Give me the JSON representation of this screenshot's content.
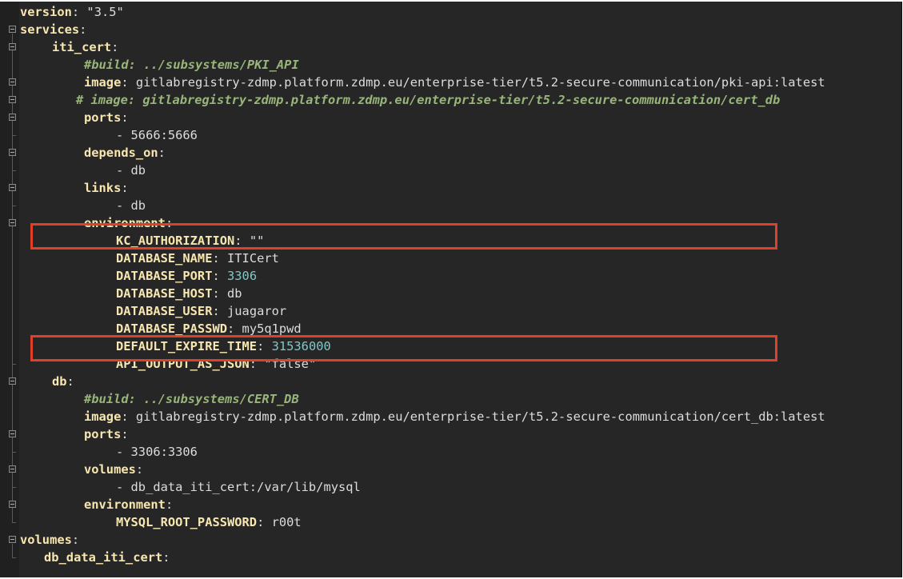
{
  "colors": {
    "editor_bg": "#262626",
    "key": "#f7e6b0",
    "text": "#dcdcdc",
    "number": "#7fc8c8",
    "comment": "#98b57a",
    "highlight_box": "#e0402a"
  },
  "lines": [
    {
      "indent": 0,
      "key": "version",
      "sep": ": ",
      "value": "\"3.5\"",
      "vtype": "plain"
    },
    {
      "indent": 0,
      "key": "services",
      "sep": ":",
      "value": "",
      "vtype": "plain"
    },
    {
      "indent": 4,
      "key": "iti_cert",
      "sep": ":",
      "value": "",
      "vtype": "plain"
    },
    {
      "indent": 8,
      "comment": "#build: ../subsystems/PKI_API"
    },
    {
      "indent": 8,
      "key": "image",
      "sep": ": ",
      "value": "gitlabregistry-zdmp.platform.zdmp.eu/enterprise-tier/t5.2-secure-communication/pki-api:latest",
      "vtype": "plain"
    },
    {
      "indent": 7,
      "comment": "# image: gitlabregistry-zdmp.platform.zdmp.eu/enterprise-tier/t5.2-secure-communication/cert_db"
    },
    {
      "indent": 8,
      "key": "ports",
      "sep": ":",
      "value": "",
      "vtype": "plain"
    },
    {
      "indent": 12,
      "text": "- 5666:5666"
    },
    {
      "indent": 8,
      "key": "depends_on",
      "sep": ":",
      "value": "",
      "vtype": "plain"
    },
    {
      "indent": 12,
      "text": "- db"
    },
    {
      "indent": 8,
      "key": "links",
      "sep": ":",
      "value": "",
      "vtype": "plain"
    },
    {
      "indent": 12,
      "text": "- db"
    },
    {
      "indent": 8,
      "key": "environment",
      "sep": ":",
      "value": "",
      "vtype": "plain"
    },
    {
      "indent": 12,
      "key": "KC_AUTHORIZATION",
      "sep": ": ",
      "value": "\"\"",
      "vtype": "plain"
    },
    {
      "indent": 12,
      "key": "DATABASE_NAME",
      "sep": ": ",
      "value": "ITICert",
      "vtype": "plain"
    },
    {
      "indent": 12,
      "key": "DATABASE_PORT",
      "sep": ": ",
      "value": "3306",
      "vtype": "num"
    },
    {
      "indent": 12,
      "key": "DATABASE_HOST",
      "sep": ": ",
      "value": "db",
      "vtype": "plain"
    },
    {
      "indent": 12,
      "key": "DATABASE_USER",
      "sep": ": ",
      "value": "juagaror",
      "vtype": "plain"
    },
    {
      "indent": 12,
      "key": "DATABASE_PASSWD",
      "sep": ": ",
      "value": "my5q1pwd",
      "vtype": "plain"
    },
    {
      "indent": 12,
      "key": "DEFAULT_EXPIRE_TIME",
      "sep": ": ",
      "value": "31536000",
      "vtype": "num"
    },
    {
      "indent": 12,
      "key": "API_OUTPUT_AS_JSON",
      "sep": ": ",
      "value": "\"false\"",
      "vtype": "plain"
    },
    {
      "indent": 4,
      "key": "db",
      "sep": ":",
      "value": "",
      "vtype": "plain"
    },
    {
      "indent": 8,
      "comment": "#build: ../subsystems/CERT_DB"
    },
    {
      "indent": 8,
      "key": "image",
      "sep": ": ",
      "value": "gitlabregistry-zdmp.platform.zdmp.eu/enterprise-tier/t5.2-secure-communication/cert_db:latest",
      "vtype": "plain"
    },
    {
      "indent": 8,
      "key": "ports",
      "sep": ":",
      "value": "",
      "vtype": "plain"
    },
    {
      "indent": 12,
      "text": "- 3306:3306"
    },
    {
      "indent": 8,
      "key": "volumes",
      "sep": ":",
      "value": "",
      "vtype": "plain"
    },
    {
      "indent": 12,
      "text": "- db_data_iti_cert:/var/lib/mysql"
    },
    {
      "indent": 8,
      "key": "environment",
      "sep": ":",
      "value": "",
      "vtype": "plain"
    },
    {
      "indent": 12,
      "key": "MYSQL_ROOT_PASSWORD",
      "sep": ": ",
      "value": "r00t",
      "vtype": "plain"
    },
    {
      "indent": 0,
      "key": "volumes",
      "sep": ":",
      "value": "",
      "vtype": "plain"
    },
    {
      "indent": 3,
      "key": "db_data_iti_cert",
      "sep": ":",
      "value": "",
      "vtype": "plain"
    }
  ]
}
